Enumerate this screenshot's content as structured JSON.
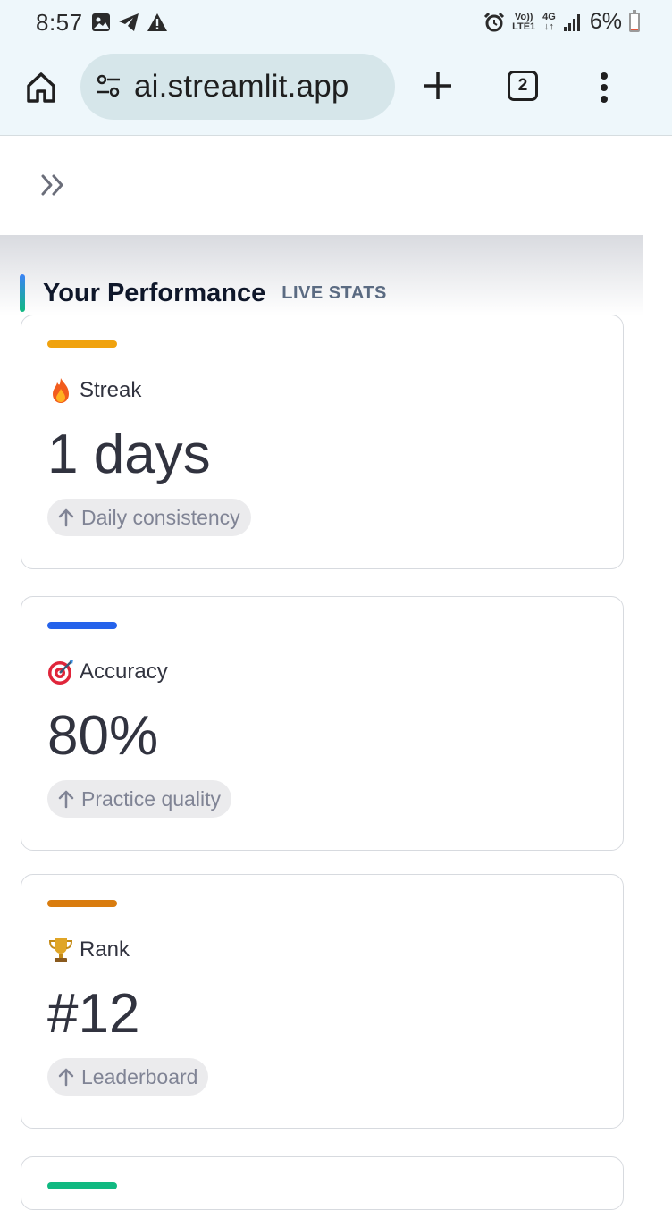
{
  "status_bar": {
    "time": "8:57",
    "net_top": "Vo))",
    "net_bottom": "LTE1",
    "gen_top": "4G",
    "gen_bottom": "↓↑",
    "battery_text": "6%",
    "battery_level": 0.06
  },
  "browser": {
    "url": "ai.streamlit.app",
    "tab_count": "2"
  },
  "section": {
    "title": "Your Performance",
    "badge": "LIVE STATS"
  },
  "cards": [
    {
      "label": "Streak",
      "value": "1 days",
      "delta": "Daily consistency",
      "accent": "#f0a20e",
      "icon": "fire-icon"
    },
    {
      "label": "Accuracy",
      "value": "80%",
      "delta": "Practice quality",
      "accent": "#2563eb",
      "icon": "target-icon"
    },
    {
      "label": "Rank",
      "value": "#12",
      "delta": "Leaderboard",
      "accent": "#d97c0e",
      "icon": "trophy-icon"
    }
  ],
  "bottom_card": {
    "accent": "#10b981"
  }
}
